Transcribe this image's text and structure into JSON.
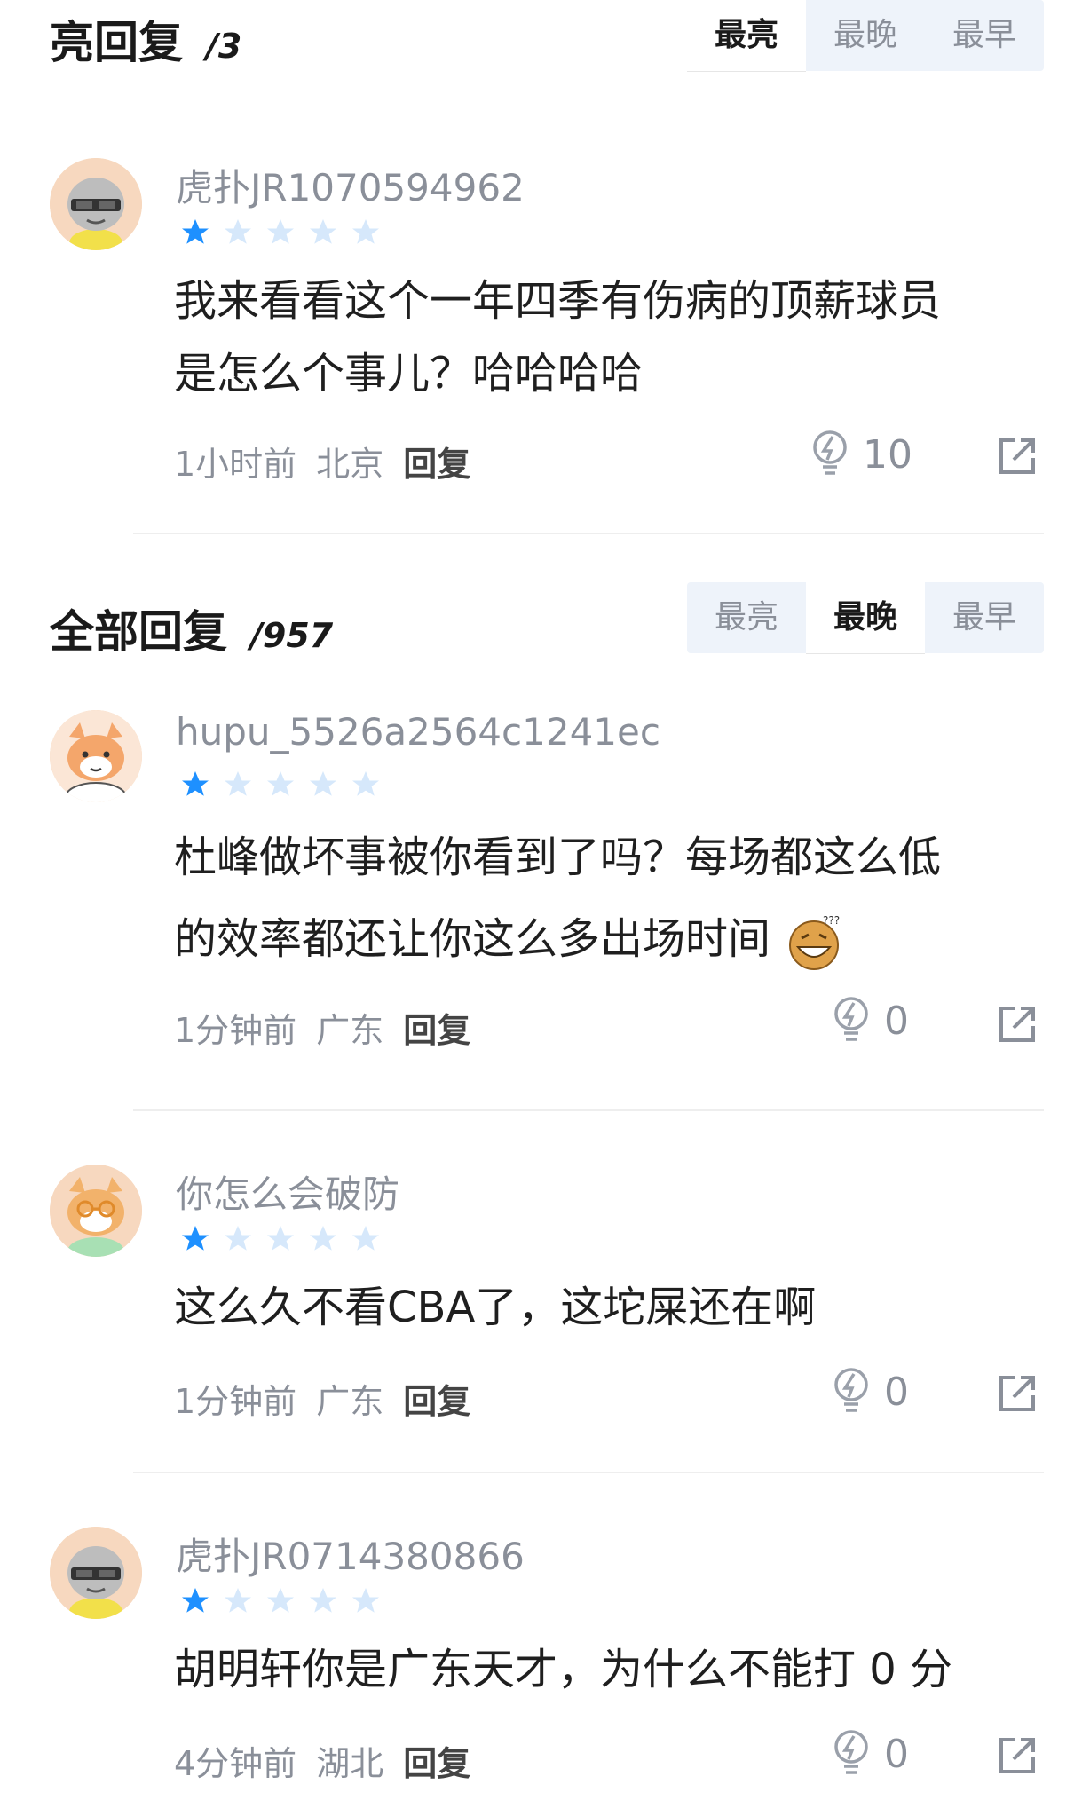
{
  "bright_section": {
    "title": "亮回复",
    "count": "/3",
    "tabs": [
      {
        "label": "最亮",
        "active": true
      },
      {
        "label": "最晚",
        "active": false
      },
      {
        "label": "最早",
        "active": false
      }
    ]
  },
  "all_section": {
    "title": "全部回复",
    "count": "/957",
    "tabs": [
      {
        "label": "最亮",
        "active": false
      },
      {
        "label": "最晚",
        "active": true
      },
      {
        "label": "最早",
        "active": false
      }
    ]
  },
  "comments": [
    {
      "username": "虎扑JR1070594962",
      "rating_stars": 1,
      "text_lines": [
        "我来看看这个一年四季有伤病的顶薪球员",
        "是怎么个事儿？哈哈哈哈"
      ],
      "time": "1小时前",
      "location": "北京",
      "reply_label": "回复",
      "light_count": "10"
    },
    {
      "username": "hupu_5526a2564c1241ec",
      "rating_stars": 1,
      "text_lines": [
        "杜峰做坏事被你看到了吗？每场都这么低",
        "的效率都还让你这么多出场时间"
      ],
      "emoji": "laughing-grin-emoji",
      "time": "1分钟前",
      "location": "广东",
      "reply_label": "回复",
      "light_count": "0"
    },
    {
      "username": "你怎么会破防",
      "rating_stars": 1,
      "text_lines": [
        "这么久不看CBA了，这坨屎还在啊"
      ],
      "time": "1分钟前",
      "location": "广东",
      "reply_label": "回复",
      "light_count": "0"
    },
    {
      "username": "虎扑JR0714380866",
      "rating_stars": 1,
      "text_lines": [
        "胡明轩你是广东天才，为什么不能打 0 分"
      ],
      "time": "4分钟前",
      "location": "湖北",
      "reply_label": "回复",
      "light_count": "0"
    }
  ],
  "icons": {
    "star_filled_color": "#1e90ff",
    "star_empty_color": "#d6e8fb",
    "light_icon": "lightbulb-icon",
    "share_icon": "share-icon"
  }
}
